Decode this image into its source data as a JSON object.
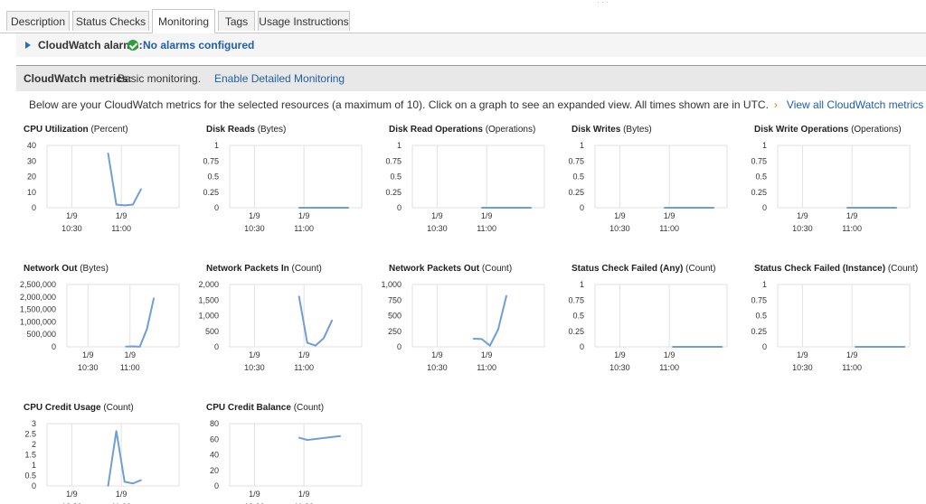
{
  "tabs": [
    {
      "label": "Description",
      "active": false
    },
    {
      "label": "Status Checks",
      "active": false
    },
    {
      "label": "Monitoring",
      "active": true
    },
    {
      "label": "Tags",
      "active": false
    },
    {
      "label": "Usage Instructions",
      "active": false
    }
  ],
  "alarms": {
    "label": "CloudWatch alarms:",
    "status_icon": "check-circle-icon",
    "value": "No alarms configured"
  },
  "metrics_header": {
    "label": "CloudWatch metrics:",
    "value": "Basic monitoring.",
    "link": "Enable Detailed Monitoring"
  },
  "description": {
    "text": "Below are your CloudWatch metrics for the selected resources (a maximum of 10). Click on a graph to see an expanded view. All times shown are in UTC.",
    "chevron": "›",
    "link": "View all CloudWatch metrics"
  },
  "x_ticks": [
    {
      "line1": "1/9",
      "line2": "10:30"
    },
    {
      "line1": "1/9",
      "line2": "11:00"
    }
  ],
  "colors": {
    "line": "#6f9ed6",
    "grid": "#e1e1e1",
    "link": "#1f5ea8",
    "ok": "#2e9e3e"
  },
  "chart_data": [
    {
      "type": "line",
      "title": "CPU Utilization",
      "unit": "(Percent)",
      "yticks": [
        "40",
        "30",
        "20",
        "10",
        "0"
      ],
      "ylim": [
        0,
        40
      ],
      "x": [
        "1/9 10:52",
        "1/9 10:57",
        "1/9 11:02",
        "1/9 11:07",
        "1/9 11:12"
      ],
      "values": [
        35,
        2,
        1.5,
        2,
        12
      ]
    },
    {
      "type": "line",
      "title": "Disk Reads",
      "unit": "(Bytes)",
      "yticks": [
        "1",
        "0.75",
        "0.5",
        "0.25",
        "0"
      ],
      "ylim": [
        0,
        1
      ],
      "x": [
        "1/9 10:57",
        "1/9 11:27"
      ],
      "values": [
        0,
        0
      ]
    },
    {
      "type": "line",
      "title": "Disk Read Operations",
      "unit": "(Operations)",
      "yticks": [
        "1",
        "0.75",
        "0.5",
        "0.25",
        "0"
      ],
      "ylim": [
        0,
        1
      ],
      "x": [
        "1/9 10:57",
        "1/9 11:27"
      ],
      "values": [
        0,
        0
      ]
    },
    {
      "type": "line",
      "title": "Disk Writes",
      "unit": "(Bytes)",
      "yticks": [
        "1",
        "0.75",
        "0.5",
        "0.25",
        "0"
      ],
      "ylim": [
        0,
        1
      ],
      "x": [
        "1/9 10:57",
        "1/9 11:27"
      ],
      "values": [
        0,
        0
      ]
    },
    {
      "type": "line",
      "title": "Disk Write Operations",
      "unit": "(Operations)",
      "yticks": [
        "1",
        "0.75",
        "0.5",
        "0.25",
        "0"
      ],
      "ylim": [
        0,
        1
      ],
      "x": [
        "1/9 10:57",
        "1/9 11:27"
      ],
      "values": [
        0,
        0
      ]
    },
    {
      "type": "line",
      "title": "Network Out",
      "unit": "(Bytes)",
      "yticks": [
        "2,500,000",
        "2,000,000",
        "1,500,000",
        "1,000,000",
        "500,000",
        "0"
      ],
      "ylim": [
        0,
        2500000
      ],
      "x": [
        "1/9 10:57",
        "1/9 11:02",
        "1/9 11:07",
        "1/9 11:12",
        "1/9 11:17"
      ],
      "values": [
        10000,
        20000,
        5000,
        700000,
        1950000
      ]
    },
    {
      "type": "line",
      "title": "Network Packets In",
      "unit": "(Count)",
      "yticks": [
        "2,000",
        "1,500",
        "1,000",
        "500",
        "0"
      ],
      "ylim": [
        0,
        2000
      ],
      "x": [
        "1/9 10:57",
        "1/9 11:02",
        "1/9 11:07",
        "1/9 11:12",
        "1/9 11:17"
      ],
      "values": [
        1620,
        130,
        40,
        280,
        850
      ]
    },
    {
      "type": "line",
      "title": "Network Packets Out",
      "unit": "(Count)",
      "yticks": [
        "1,000",
        "750",
        "500",
        "250",
        "0"
      ],
      "ylim": [
        0,
        1000
      ],
      "x": [
        "1/9 10:52",
        "1/9 10:57",
        "1/9 11:02",
        "1/9 11:07",
        "1/9 11:12"
      ],
      "values": [
        130,
        125,
        20,
        280,
        820
      ]
    },
    {
      "type": "line",
      "title": "Status Check Failed (Any)",
      "unit": "(Count)",
      "yticks": [
        "1",
        "0.75",
        "0.5",
        "0.25",
        "0"
      ],
      "ylim": [
        0,
        1
      ],
      "x": [
        "1/9 11:02",
        "1/9 11:32"
      ],
      "values": [
        0,
        0
      ]
    },
    {
      "type": "line",
      "title": "Status Check Failed (Instance)",
      "unit": "(Count)",
      "yticks": [
        "1",
        "0.75",
        "0.5",
        "0.25",
        "0"
      ],
      "ylim": [
        0,
        1
      ],
      "x": [
        "1/9 11:02",
        "1/9 11:32"
      ],
      "values": [
        0,
        0
      ]
    },
    {
      "type": "line",
      "title": "CPU Credit Usage",
      "unit": "(Count)",
      "yticks": [
        "3",
        "2.5",
        "2",
        "1.5",
        "1",
        "0.5",
        "0"
      ],
      "ylim": [
        0,
        3
      ],
      "x": [
        "1/9 10:52",
        "1/9 10:57",
        "1/9 11:02",
        "1/9 11:07",
        "1/9 11:12"
      ],
      "values": [
        0,
        2.65,
        0.2,
        0.12,
        0.28
      ]
    },
    {
      "type": "line",
      "title": "CPU Credit Balance",
      "unit": "(Count)",
      "yticks": [
        "80",
        "60",
        "40",
        "20",
        "0"
      ],
      "ylim": [
        0,
        80
      ],
      "x": [
        "1/9 10:57",
        "1/9 11:02",
        "1/9 11:22"
      ],
      "values": [
        62,
        59,
        64
      ]
    }
  ]
}
